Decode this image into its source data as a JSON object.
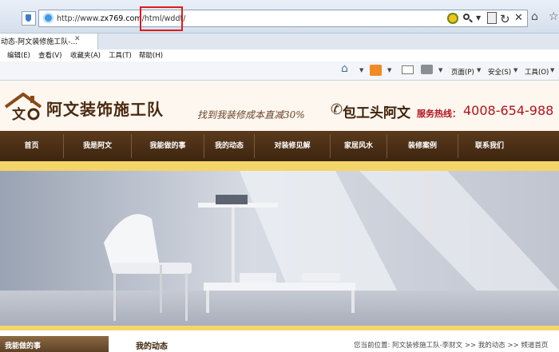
{
  "browser": {
    "url_prefix": "http://www.",
    "url_domain": "zx769.com",
    "url_path": "/html/wddt/",
    "tab_title": "动态-阿文装修施工队-...",
    "menu": [
      "编辑(E)",
      "查看(V)",
      "收藏夹(A)",
      "工具(T)",
      "帮助(H)"
    ],
    "command_bar": {
      "page": "页面(P)",
      "safety": "安全(S)",
      "tools": "工具(O)"
    }
  },
  "site": {
    "name": "阿文装饰施工队",
    "slogan": "找到我装修成本直减30%",
    "bao_text": "包工头阿文",
    "hotline_label": "服务热线：",
    "hotline_number": "4008-654-988",
    "nav": [
      "首页",
      "我是阿文",
      "我能做的事",
      "我的动态",
      "对装修见解",
      "家居风水",
      "装修案例",
      "联系我们"
    ],
    "sidebar_title": "我能做的事",
    "main_title": "我的动态",
    "breadcrumb": "您当前位置: 阿文装修施工队-李财文 >> 我的动态 >> 频道首页"
  },
  "colors": {
    "brand_brown": "#4a2a10",
    "hotline_red": "#b4121c",
    "banner_yellow": "#f4d56a",
    "highlight_red": "#e01b1b"
  }
}
